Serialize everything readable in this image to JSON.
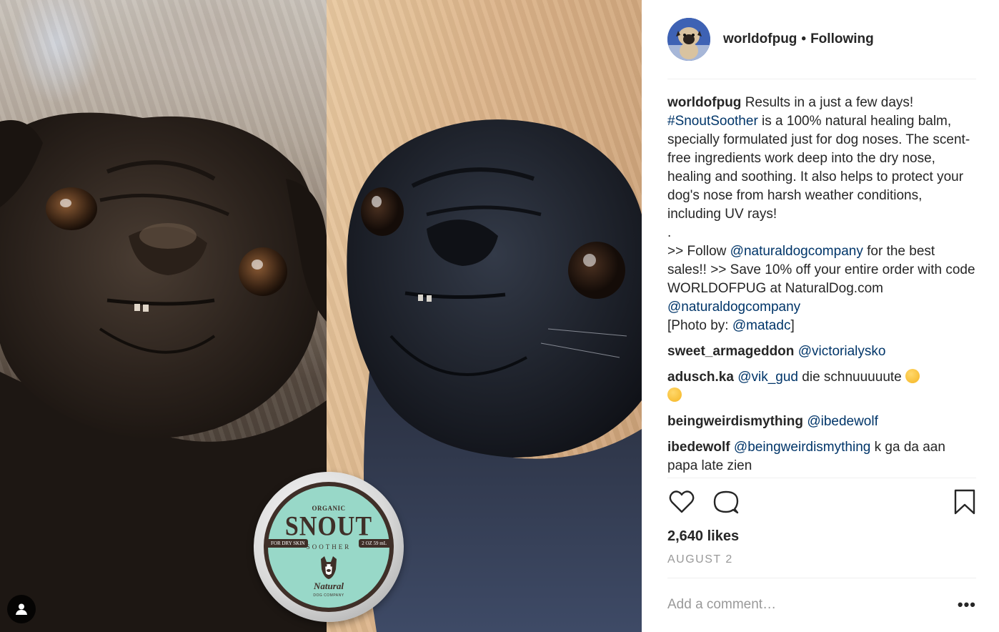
{
  "header": {
    "username": "worldofpug",
    "separator": "•",
    "follow_status": "Following"
  },
  "caption": {
    "username": "worldofpug",
    "text_1": " Results in a just a few days! ",
    "hashtag": "#SnoutSoother",
    "text_2": " is a 100% natural healing balm, specially formulated just for dog noses. The scent-free ingredients work deep into the dry nose, healing and soothing. It also helps to protect your dog's nose from harsh weather conditions, including UV rays!",
    "dot": ".",
    "text_3": ">> Follow ",
    "mention_1": "@naturaldogcompany",
    "text_4": " for the best sales!! >> Save 10% off your entire order with code WORLDOFPUG at NaturalDog.com ",
    "mention_2": "@naturaldogcompany",
    "text_5": "[Photo by: ",
    "mention_3": "@matadc",
    "text_6": "]"
  },
  "comments": [
    {
      "username": "sweet_armageddon",
      "mention": "@victorialysko",
      "text": ""
    },
    {
      "username": "adusch.ka",
      "mention": "@vik_gud",
      "text": " die schnuuuuute "
    },
    {
      "username": "beingweirdismything",
      "mention": "@ibedewolf",
      "text": ""
    },
    {
      "username": "ibedewolf",
      "mention": "@beingweirdismything",
      "text": " k ga da aan papa late zien"
    }
  ],
  "likes": "2,640 likes",
  "date": "AUGUST 2",
  "add_comment": {
    "placeholder": "Add a comment…"
  },
  "more": "•••",
  "product": {
    "organic": "ORGANIC",
    "name": "SNOUT",
    "sub": "SOOTHER",
    "left_label": "FOR DRY SKIN",
    "right_label": "2 OZ 59 mL",
    "brand": "Natural",
    "brand_sub": "DOG COMPANY"
  },
  "colors": {
    "link": "#003569",
    "muted": "#999999",
    "text": "#262626",
    "tin_label": "#98d8c8"
  }
}
